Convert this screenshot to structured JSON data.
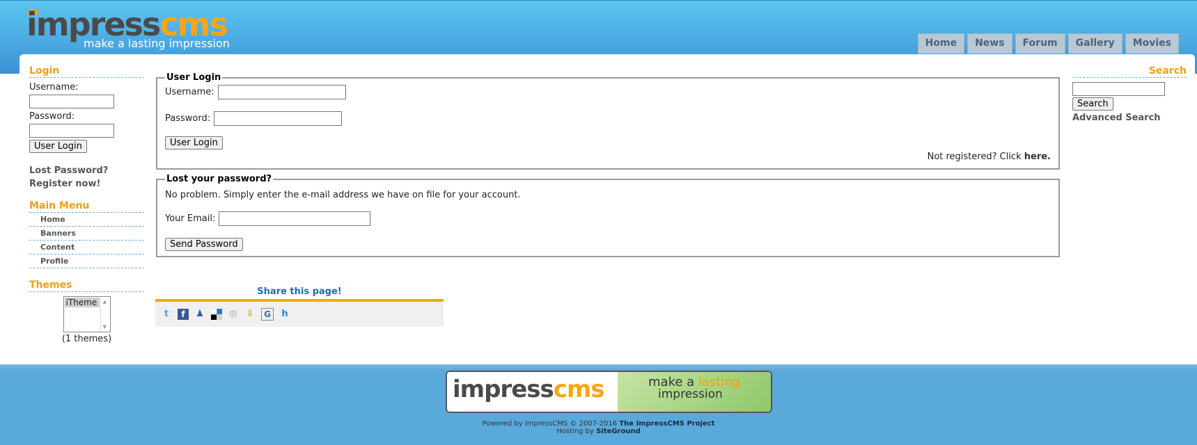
{
  "header": {
    "logo_main_a": "impress",
    "logo_main_b": "cms",
    "logo_tagline": "make a lasting impression",
    "nav": [
      "Home",
      "News",
      "Forum",
      "Gallery",
      "Movies"
    ]
  },
  "left": {
    "login_title": "Login",
    "username_label": "Username:",
    "password_label": "Password:",
    "login_button": "User Login",
    "lost_password": "Lost Password?",
    "register": "Register now!",
    "menu_title": "Main Menu",
    "menu_items": [
      "Home",
      "Banners",
      "Content",
      "Profile"
    ],
    "themes_title": "Themes",
    "theme_option": "iTheme",
    "theme_count": "(1 themes)"
  },
  "center": {
    "user_login_legend": "User Login",
    "username_label": "Username:",
    "password_label": "Password:",
    "login_button": "User Login",
    "not_registered": "Not registered? Click ",
    "here_link": "here.",
    "lost_legend": "Lost your password?",
    "lost_desc": "No problem. Simply enter the e-mail address we have on file for your account.",
    "email_label": "Your Email:",
    "send_button": "Send Password",
    "share_title": "Share this page!"
  },
  "right": {
    "search_title": "Search",
    "search_button": "Search",
    "advanced_search": "Advanced Search"
  },
  "footer": {
    "banner_left_a": "impress",
    "banner_left_b": "cms",
    "banner_make": "make a ",
    "banner_lasting": "lasting",
    "banner_impression": "impression",
    "powered_prefix": "Powered by ImpressCMS © 2007-2016 ",
    "powered_project": "The ImpressCMS Project",
    "hosting_prefix": "Hosting by ",
    "hosting_name": "SiteGround"
  },
  "colors": {
    "accent_orange": "#f0a010",
    "header_blue": "#4aa7e0",
    "link_blue": "#1a6bbf"
  }
}
